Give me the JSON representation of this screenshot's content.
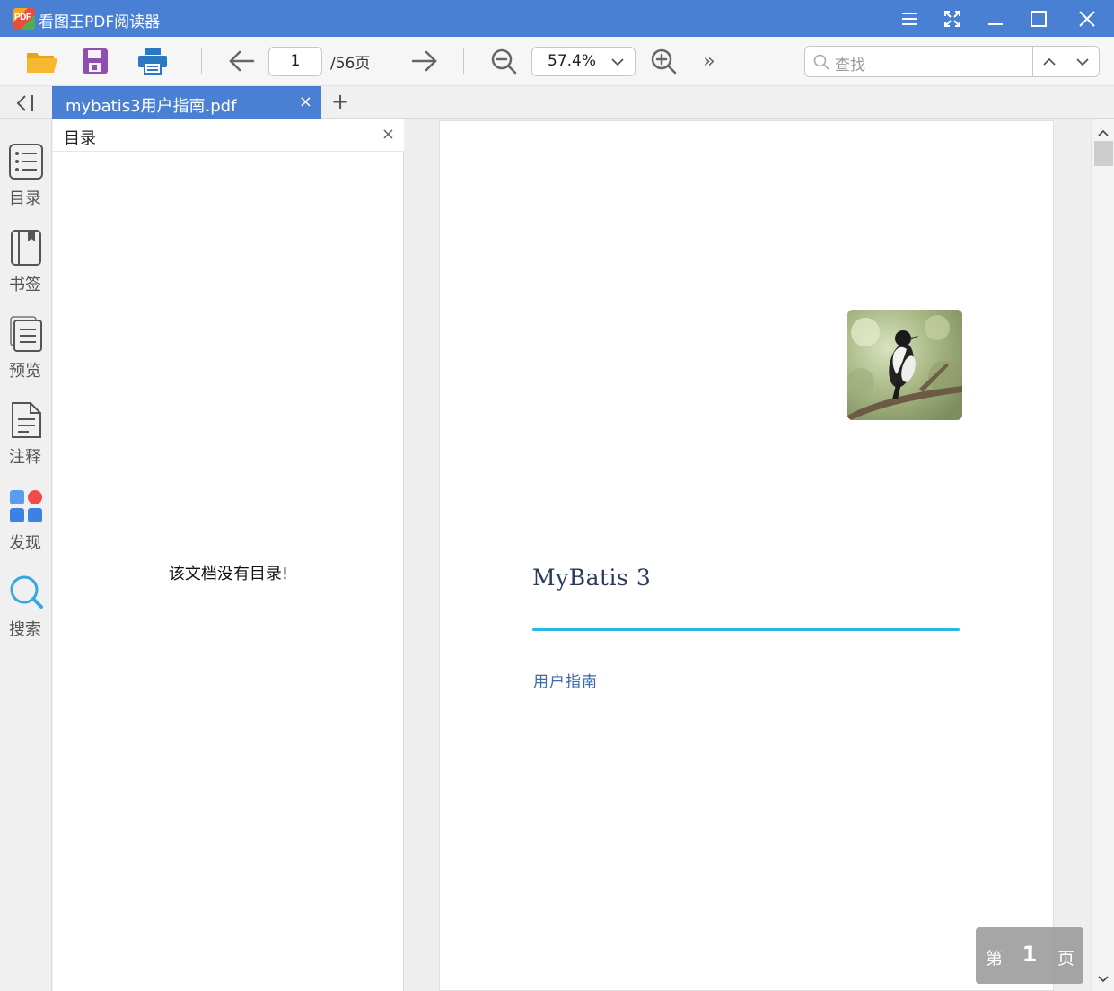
{
  "app": {
    "title": "看图王PDF阅读器",
    "logo_text": "PDF"
  },
  "window_controls": [
    "menu-icon",
    "fullscreen-icon",
    "minimize-icon",
    "maximize-icon",
    "close-icon"
  ],
  "toolbar": {
    "open_icon": "folder-open-icon",
    "save_icon": "save-icon",
    "print_icon": "print-icon",
    "prev_icon": "arrow-left-icon",
    "current_page": "1",
    "page_total": "/56页",
    "next_icon": "arrow-right-icon",
    "zoom_out_icon": "zoom-out-icon",
    "zoom_value": "57.4%",
    "zoom_in_icon": "zoom-in-icon",
    "more_label": "»",
    "search_placeholder": "查找"
  },
  "tabs": {
    "active_label": "mybatis3用户指南.pdf",
    "close_label": "×",
    "add_label": "+"
  },
  "rail": {
    "items": [
      {
        "label": "目录",
        "icon": "toc-list-icon"
      },
      {
        "label": "书签",
        "icon": "bookmark-icon"
      },
      {
        "label": "预览",
        "icon": "preview-pages-icon"
      },
      {
        "label": "注释",
        "icon": "annotation-document-icon"
      },
      {
        "label": "发现",
        "icon": "discover-grid-icon"
      },
      {
        "label": "搜索",
        "icon": "search-icon"
      }
    ]
  },
  "toc_panel": {
    "title": "目录",
    "close_label": "×",
    "empty_message": "该文档没有目录!"
  },
  "document": {
    "title": "MyBatis 3",
    "subtitle": "用户指南",
    "image": "bird-photo",
    "accent_color": "#27b8e6"
  },
  "page_indicator": {
    "prefix": "第",
    "number": "1",
    "suffix": "页"
  },
  "colors": {
    "titlebar": "#4a80d4",
    "tab_active": "#4a80d4"
  }
}
